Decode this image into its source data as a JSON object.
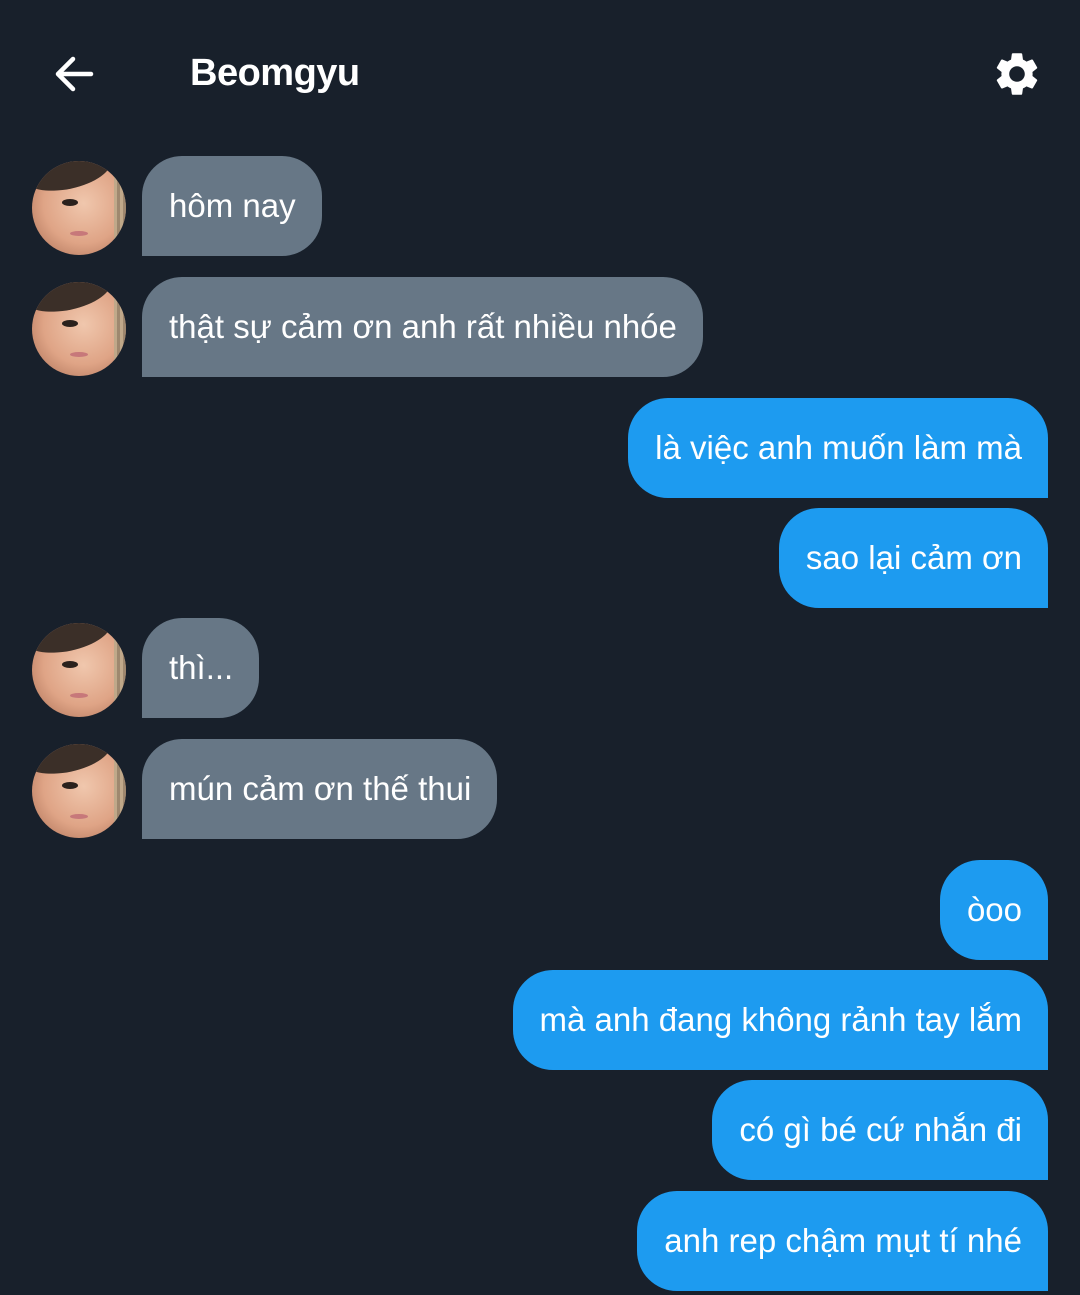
{
  "header": {
    "title": "Beomgyu",
    "back_icon": "arrow-left-icon",
    "settings_icon": "gear-icon"
  },
  "colors": {
    "background": "#18202b",
    "incoming_bubble": "#677786",
    "outgoing_bubble": "#1d9bf0",
    "text": "#ffffff"
  },
  "messages": [
    {
      "side": "incoming",
      "text": "hôm nay"
    },
    {
      "side": "incoming",
      "text": "thật sự cảm ơn anh rất nhiều nhóe"
    },
    {
      "side": "outgoing",
      "text": "là việc anh muốn làm mà"
    },
    {
      "side": "outgoing",
      "text": "sao lại cảm ơn"
    },
    {
      "side": "incoming",
      "text": "thì..."
    },
    {
      "side": "incoming",
      "text": "mún cảm ơn thế thui"
    },
    {
      "side": "outgoing",
      "text": "òoo"
    },
    {
      "side": "outgoing",
      "text": "mà anh đang không rảnh tay lắm"
    },
    {
      "side": "outgoing",
      "text": "có gì bé cứ nhắn đi"
    },
    {
      "side": "outgoing",
      "text": "anh rep chậm mụt tí nhé"
    }
  ]
}
